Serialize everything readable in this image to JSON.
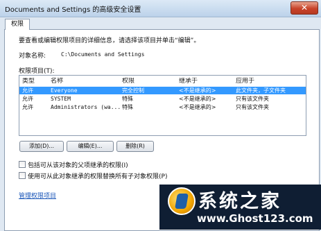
{
  "window": {
    "title": "Documents and Settings 的高级安全设置",
    "close_glyph": "✕"
  },
  "tab": {
    "label": "权限"
  },
  "description": "要查看或编辑权限项目的详细信息，请选择该项目并单击“编辑”。",
  "object_name": {
    "label": "对象名称:",
    "value": "C:\\Documents and Settings"
  },
  "permission_entries": {
    "label": "权限项目(T):",
    "columns": [
      "类型",
      "名称",
      "权限",
      "继承于",
      "应用于"
    ],
    "rows": [
      {
        "type": "允许",
        "name": "Everyone",
        "permission": "完全控制",
        "inherited_from": "<不是继承的>",
        "applies_to": "此文件夹，子文件夹"
      },
      {
        "type": "允许",
        "name": "SYSTEM",
        "permission": "特殊",
        "inherited_from": "<不是继承的>",
        "applies_to": "只有该文件夹"
      },
      {
        "type": "允许",
        "name": "Administrators (wa...",
        "permission": "特殊",
        "inherited_from": "<不是继承的>",
        "applies_to": "只有该文件夹"
      }
    ],
    "selected_row": 0
  },
  "buttons": {
    "add": "添加(D)...",
    "edit": "编辑(E)...",
    "remove": "删除(R)"
  },
  "checkboxes": {
    "include_inheritable": {
      "label": "包括可从该对象的父项继承的权限(I)",
      "checked": false
    },
    "replace_child": {
      "label": "使用可从此对象继承的权限替换所有子对象权限(P)",
      "checked": false
    }
  },
  "link": {
    "label": "管理权限项目"
  },
  "watermark": {
    "cn": "系统之家",
    "url": "www.Ghost123.com"
  },
  "colors": {
    "selection": "#3399ff",
    "link": "#1a56b8",
    "close": "#c8432a"
  }
}
